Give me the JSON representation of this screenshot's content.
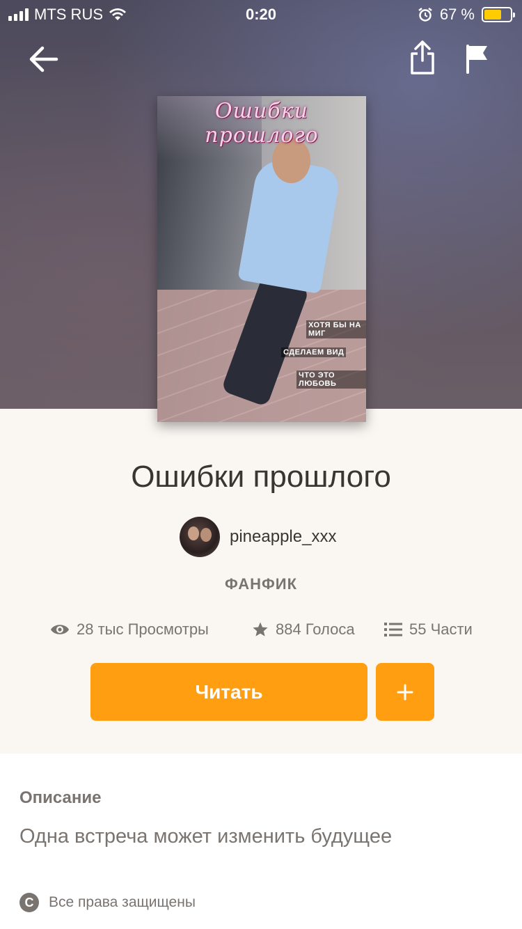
{
  "status_bar": {
    "carrier": "MTS RUS",
    "time": "0:20",
    "battery_percent": "67 %",
    "battery_level": 0.67
  },
  "header": {
    "back_icon": "arrow-left-icon",
    "share_icon": "share-icon",
    "report_icon": "flag-icon"
  },
  "cover": {
    "title_art": "Ошибки прошлого",
    "captions": [
      "ХОТЯ БЫ НА МИГ",
      "СДЕЛАЕМ ВИД",
      "ЧТО ЭТО ЛЮБОВЬ"
    ]
  },
  "story": {
    "title": "Ошибки прошлого",
    "author": "pineapple_xxx",
    "genre": "ФАНФИК",
    "stats": {
      "views": "28 тыс Просмотры",
      "votes": "884 Голоса",
      "parts": "55 Части"
    }
  },
  "actions": {
    "read_label": "Читать",
    "add_label": "+"
  },
  "description": {
    "label": "Описание",
    "text": "Одна встреча может изменить будущее",
    "copyright": "Все права защищены",
    "copyright_symbol": "C"
  },
  "colors": {
    "accent": "#ff9e10",
    "battery": "#ffcc00",
    "text_muted": "#7a7470"
  }
}
